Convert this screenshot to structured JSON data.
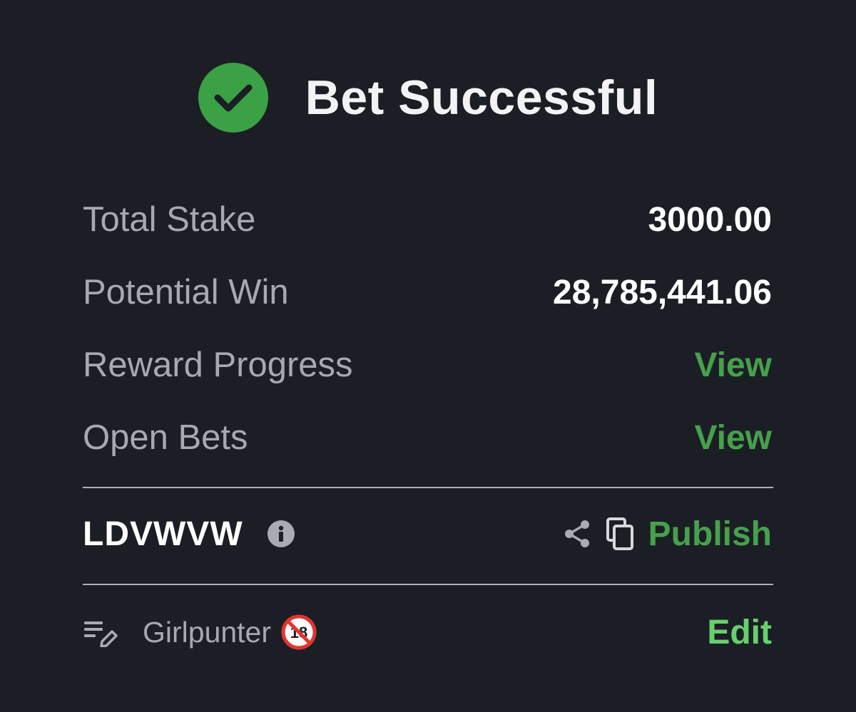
{
  "header": {
    "title": "Bet Successful",
    "icon": "check-circle-icon",
    "icon_color": "#3aa144"
  },
  "summary": {
    "total_stake_label": "Total Stake",
    "total_stake_value": "3000.00",
    "potential_win_label": "Potential Win",
    "potential_win_value": "28,785,441.06",
    "reward_progress_label": "Reward Progress",
    "reward_progress_link": "View",
    "open_bets_label": "Open Bets",
    "open_bets_link": "View"
  },
  "booking": {
    "code": "LDVWVW",
    "info_icon": "info-icon",
    "share_icon": "share-icon",
    "copy_icon": "copy-icon",
    "publish_label": "Publish"
  },
  "footer": {
    "note_icon": "notes-edit-icon",
    "username": "Girlpunter",
    "badge_icon": "no-under-18-icon",
    "edit_label": "Edit"
  },
  "colors": {
    "background": "#1c1e25",
    "accent_green": "#46a04c",
    "edit_green": "#66d06d",
    "muted_text": "#a7a9b1"
  }
}
